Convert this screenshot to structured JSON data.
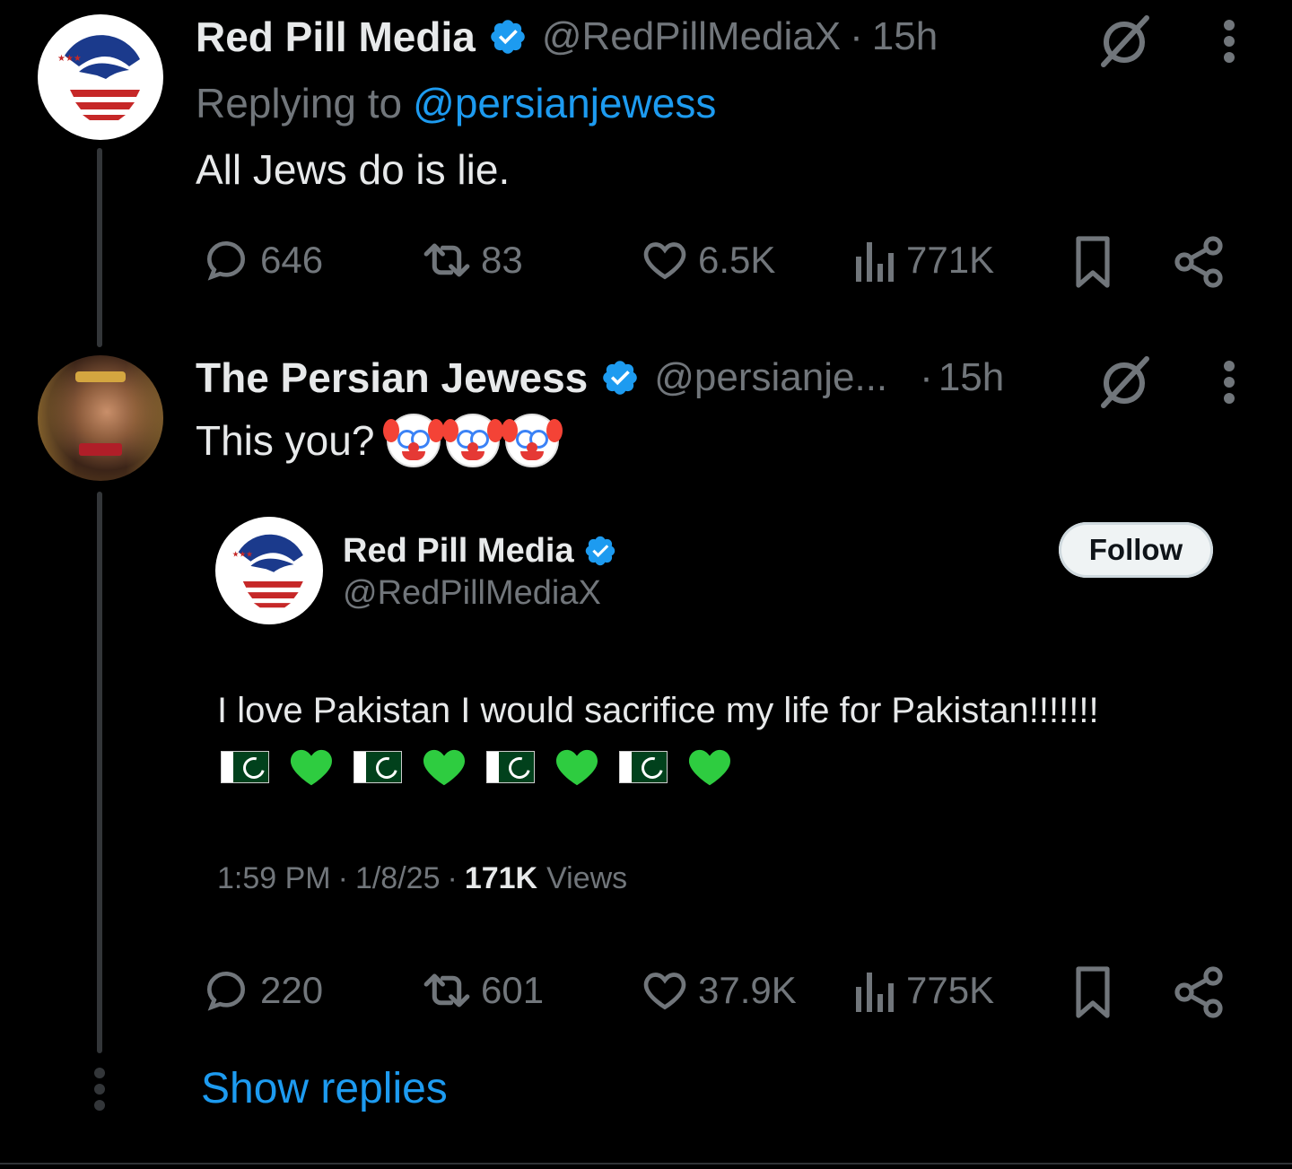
{
  "tweet1": {
    "display_name": "Red Pill Media",
    "handle": "@RedPillMediaX",
    "separator": "·",
    "time": "15h",
    "replying_prefix": "Replying to",
    "replying_handle": "@persianjewess",
    "text": "All Jews do is lie.",
    "stats": {
      "replies": "646",
      "reposts": "83",
      "likes": "6.5K",
      "views": "771K"
    }
  },
  "tweet2": {
    "display_name": "The Persian Jewess",
    "handle": "@persianje...",
    "separator": "·",
    "time": "15h",
    "text": "This you?",
    "emoji": [
      "clown-face",
      "clown-face",
      "clown-face"
    ],
    "quoted": {
      "display_name": "Red Pill Media",
      "handle": "@RedPillMediaX",
      "follow_label": "Follow",
      "text": "I love Pakistan I would sacrifice my life for Pakistan!!!!!!!",
      "emoji_row": [
        "pakistan-flag",
        "green-heart",
        "pakistan-flag",
        "green-heart",
        "pakistan-flag",
        "green-heart",
        "pakistan-flag",
        "green-heart"
      ],
      "time": "1:59 PM",
      "dot1": "·",
      "date": "1/8/25",
      "dot2": "·",
      "views_count": "171K",
      "views_label": "Views"
    },
    "stats": {
      "replies": "220",
      "reposts": "601",
      "likes": "37.9K",
      "views": "775K"
    }
  },
  "show_replies_label": "Show replies",
  "colors": {
    "background": "#000000",
    "text": "#e7e9ea",
    "muted": "#71767b",
    "accent": "#1d9bf0",
    "verified": "#1d9bf0"
  }
}
